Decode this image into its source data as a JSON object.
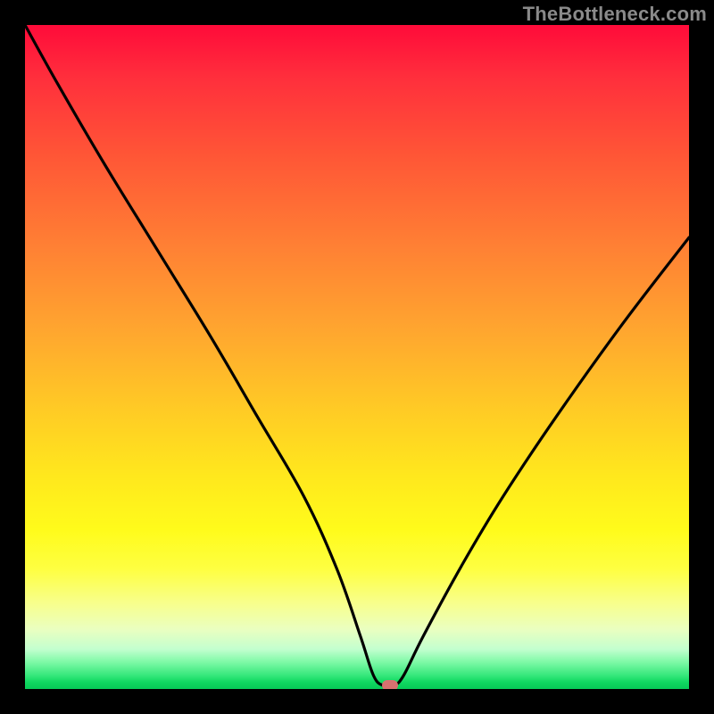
{
  "watermark": "TheBottleneck.com",
  "colors": {
    "frame": "#000000",
    "marker": "#d6716f",
    "curve": "#000000"
  },
  "chart_data": {
    "type": "line",
    "title": "",
    "xlabel": "",
    "ylabel": "",
    "xlim": [
      0,
      100
    ],
    "ylim": [
      0,
      100
    ],
    "grid": false,
    "legend": false,
    "series": [
      {
        "name": "bottleneck-curve",
        "x": [
          0,
          5,
          12,
          20,
          28,
          35,
          42,
          47,
          50.5,
          52.5,
          54,
          55.5,
          57,
          60,
          66,
          72,
          80,
          90,
          100
        ],
        "values": [
          100,
          91,
          79,
          66,
          53,
          41,
          29,
          18,
          8,
          2,
          0.5,
          0.5,
          2,
          8,
          19,
          29,
          41,
          55,
          68
        ]
      }
    ],
    "marker": {
      "x": 55,
      "y": 0.5
    },
    "gradient_stops": [
      {
        "pos": 0,
        "color": "#ff0b3a"
      },
      {
        "pos": 8,
        "color": "#ff2f3c"
      },
      {
        "pos": 20,
        "color": "#ff5736"
      },
      {
        "pos": 33,
        "color": "#ff7f34"
      },
      {
        "pos": 46,
        "color": "#ffa62f"
      },
      {
        "pos": 58,
        "color": "#ffcb25"
      },
      {
        "pos": 68,
        "color": "#ffe81d"
      },
      {
        "pos": 76,
        "color": "#fffb1b"
      },
      {
        "pos": 82,
        "color": "#feff42"
      },
      {
        "pos": 87,
        "color": "#f8ff8b"
      },
      {
        "pos": 91,
        "color": "#eaffc0"
      },
      {
        "pos": 94,
        "color": "#c3ffcf"
      },
      {
        "pos": 96,
        "color": "#7cf9a5"
      },
      {
        "pos": 98,
        "color": "#34e77a"
      },
      {
        "pos": 99,
        "color": "#0fd860"
      },
      {
        "pos": 100,
        "color": "#07c957"
      }
    ]
  }
}
